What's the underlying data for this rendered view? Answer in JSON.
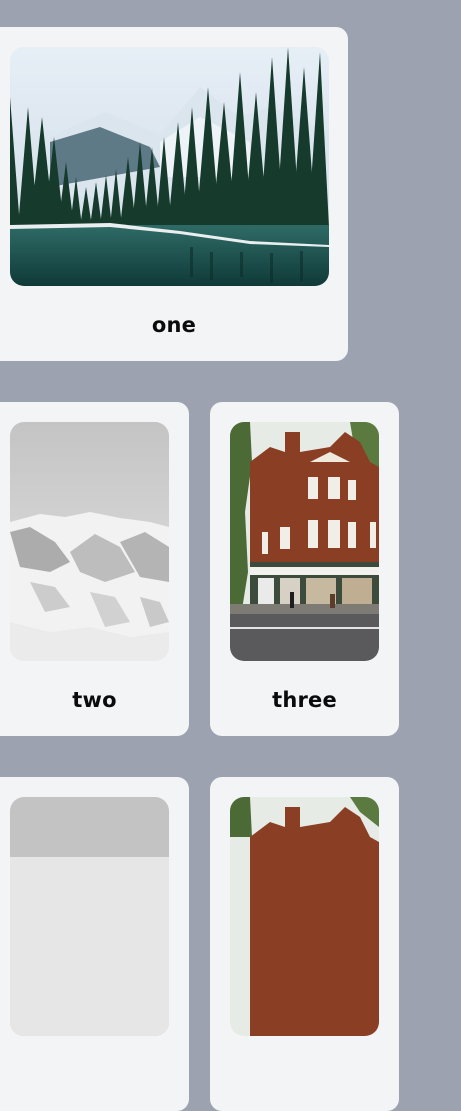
{
  "gallery": {
    "cards": [
      {
        "caption": "one",
        "image": "forest-lake-photo"
      },
      {
        "caption": "two",
        "image": "snowy-mountain-photo"
      },
      {
        "caption": "three",
        "image": "brick-building-photo"
      },
      {
        "caption": "",
        "image": "snowy-mountain-photo"
      },
      {
        "caption": "",
        "image": "brick-building-photo"
      }
    ]
  },
  "colors": {
    "background": "#9ca2af",
    "card": "#f3f4f6",
    "caption_text": "#0b0b0b"
  }
}
